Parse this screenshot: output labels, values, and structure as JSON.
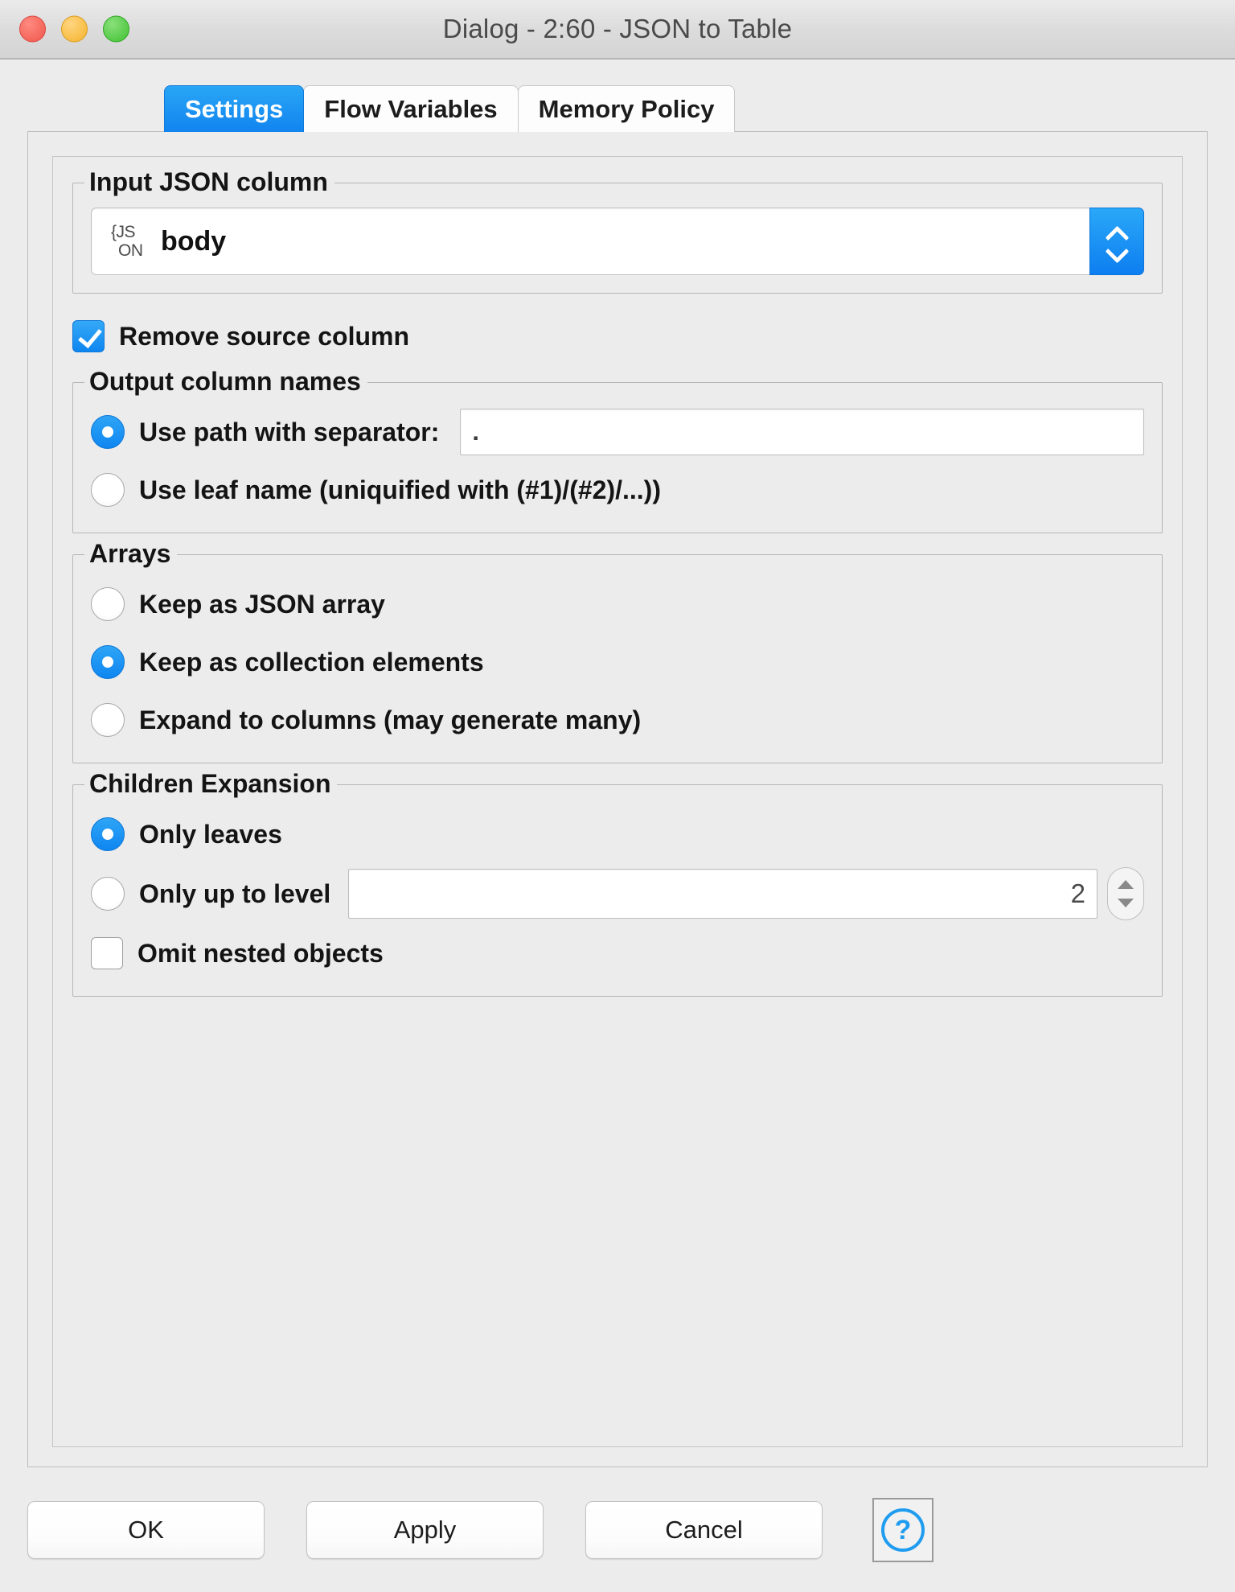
{
  "window": {
    "title": "Dialog - 2:60 - JSON to Table",
    "traffic_lights": [
      "close",
      "minimize",
      "maximize"
    ]
  },
  "tabs": [
    {
      "label": "Settings",
      "active": true
    },
    {
      "label": "Flow Variables",
      "active": false
    },
    {
      "label": "Memory Policy",
      "active": false
    }
  ],
  "settings": {
    "input_json_column": {
      "group_title": "Input JSON column",
      "icon_line1": "{JS",
      "icon_line2": "ON",
      "value": "body"
    },
    "remove_source_column": {
      "label": "Remove source column",
      "checked": true
    },
    "output_column_names": {
      "group_title": "Output column names",
      "option_path": "Use path with separator:",
      "separator_value": ".",
      "option_leaf": "Use leaf name (uniquified with (#1)/(#2)/...))"
    },
    "arrays": {
      "group_title": "Arrays",
      "option_json_array": "Keep as JSON array",
      "option_collection": "Keep as collection elements",
      "option_expand": "Expand to columns (may generate many)"
    },
    "children_expansion": {
      "group_title": "Children Expansion",
      "option_leaves": "Only leaves",
      "option_level": "Only up to level",
      "level_value": "2",
      "omit_nested": "Omit nested objects"
    }
  },
  "footer": {
    "ok": "OK",
    "apply": "Apply",
    "cancel": "Cancel",
    "help": "?"
  },
  "colors": {
    "accent": "#0f86f0",
    "window_bg": "#ececec",
    "titlebar_text": "#4a4a4a"
  }
}
